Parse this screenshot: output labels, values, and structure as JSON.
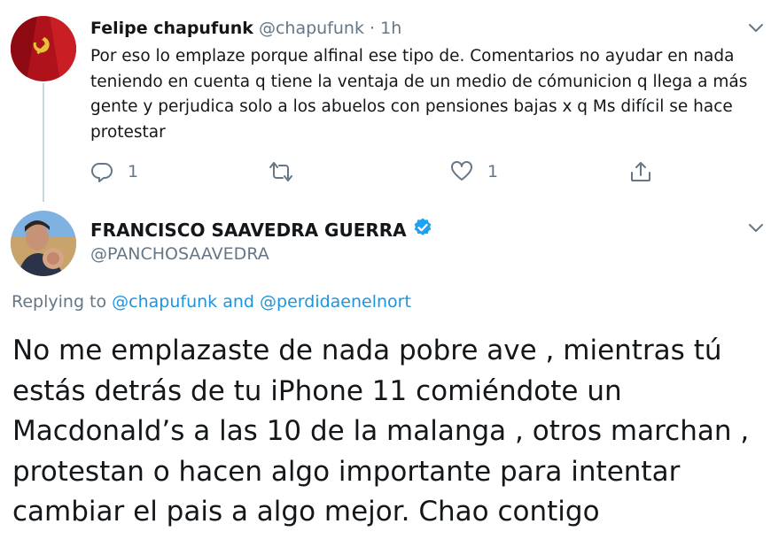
{
  "tweet1": {
    "name": "Felipe chapufunk",
    "handle": "@chapufunk",
    "separator": "·",
    "time": "1h",
    "text": "Por eso lo emplaze porque alfinal ese tipo de. Comentarios no ayudar en nada teniendo en cuenta q tiene la ventaja de un medio de cómunicion q llega a más gente y perjudica solo a los abuelos con pensiones bajas x q Ms difícil se hace protestar",
    "reply_count": "1",
    "retweet_count": "",
    "like_count": "1",
    "icons": [
      "reply-icon",
      "retweet-icon",
      "like-icon",
      "share-icon",
      "chevron-down-icon"
    ]
  },
  "tweet2": {
    "name": "FRANCISCO SAAVEDRA GUERRA",
    "handle": "@PANCHOSAAVEDRA",
    "verified": true,
    "replying_prefix": "Replying to",
    "replying_user1": "@chapufunk",
    "replying_and": "and",
    "replying_user2": "@perdidaenelnort",
    "text": "No me emplazaste de nada pobre ave , mientras tú estás detrás de tu iPhone 11 comiéndote un Macdonald’s a las 10 de la malanga , otros marchan , protestan o hacen algo importante para intentar cambiar el pais a algo mejor. Chao contigo"
  },
  "colors": {
    "text": "#14171a",
    "muted": "#657786",
    "link": "#1b95e0",
    "thread_line": "#ccd6dd",
    "verified": "#1da1f2"
  }
}
